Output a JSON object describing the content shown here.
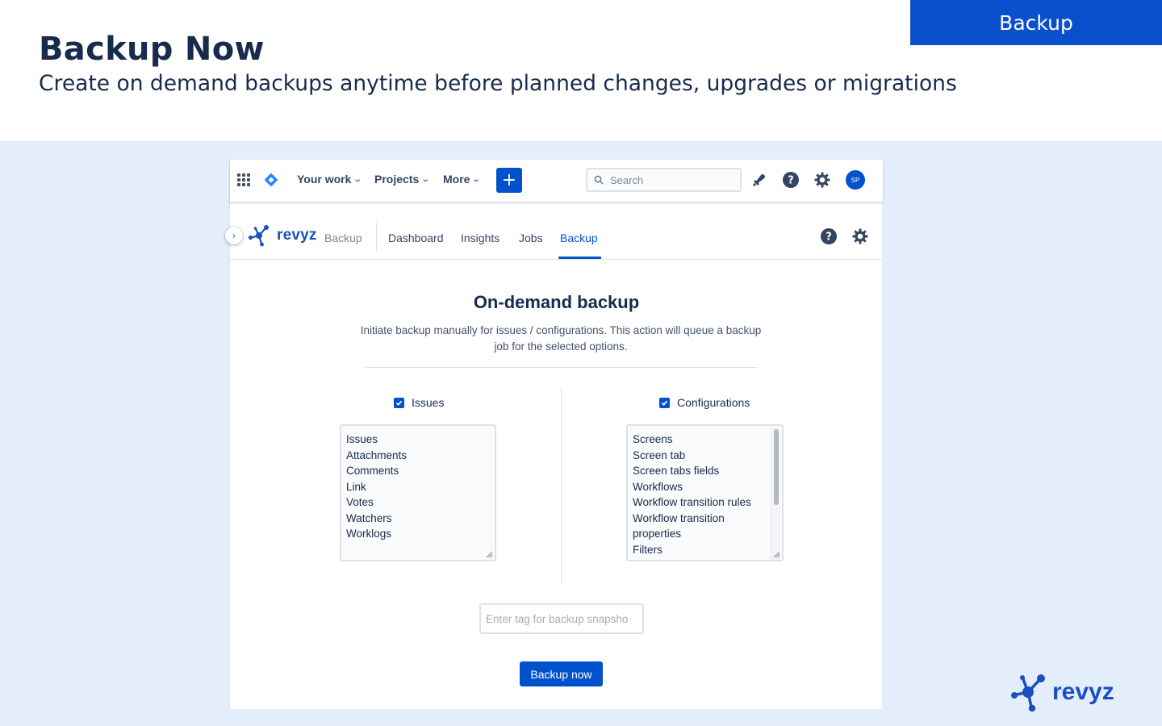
{
  "hero": {
    "title": "Backup Now",
    "subtitle": "Create on demand backups anytime before planned changes, upgrades or migrations",
    "corner_tag": "Backup"
  },
  "topnav": {
    "items": [
      "Your work",
      "Projects",
      "More"
    ],
    "create_label": "+",
    "search_placeholder": "Search",
    "avatar_initials": "SP"
  },
  "subnav": {
    "brand": "revyz",
    "app_name": "Backup",
    "tabs": [
      "Dashboard",
      "Insights",
      "Jobs",
      "Backup"
    ],
    "active_tab": "Backup"
  },
  "main": {
    "title": "On-demand backup",
    "description": "Initiate backup manually for issues / configurations. This action will queue a backup job for the selected options.",
    "issues": {
      "label": "Issues",
      "checked": true,
      "items": [
        "Issues",
        "Attachments",
        "Comments",
        "Link",
        "Votes",
        "Watchers",
        "Worklogs"
      ]
    },
    "configurations": {
      "label": "Configurations",
      "checked": true,
      "items": [
        "Screens",
        "Screen tab",
        "Screen tabs fields",
        "Workflows",
        "Workflow transition rules",
        "Workflow transition",
        "properties",
        "Filters"
      ]
    },
    "tag_placeholder": "Enter tag for backup snapsho",
    "backup_button": "Backup now"
  },
  "footer": {
    "brand": "revyz"
  },
  "colors": {
    "accent": "#0052cc",
    "stage_bg": "#e3edfb",
    "brand_blue": "#1b4fbf"
  }
}
